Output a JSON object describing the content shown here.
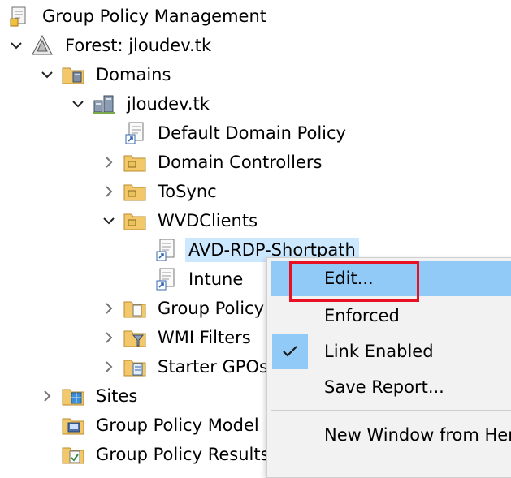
{
  "tree": {
    "root": "Group Policy Management",
    "forest": "Forest: jloudev.tk",
    "domains": "Domains",
    "domain": "jloudev.tk",
    "default_domain_policy": "Default Domain Policy",
    "domain_controllers": "Domain Controllers",
    "tosync": "ToSync",
    "wvdclients": "WVDClients",
    "avd_rdp": "AVD-RDP-Shortpath",
    "intune": "Intune",
    "group_policy_objects": "Group Policy",
    "wmi_filters": "WMI Filters",
    "starter_gpos": "Starter GPOs",
    "sites": "Sites",
    "gp_modeling": "Group Policy Model",
    "gp_results": "Group Policy Results"
  },
  "context_menu": {
    "edit": "Edit...",
    "enforced": "Enforced",
    "link_enabled": "Link Enabled",
    "save_report": "Save Report...",
    "new_window": "New Window from Her"
  },
  "colors": {
    "selection": "#cce8ff",
    "menu_hover": "#91c9f7",
    "menu_bg": "#f2f2f2",
    "highlight_box": "#e81123"
  },
  "state": {
    "link_enabled_checked": true
  }
}
